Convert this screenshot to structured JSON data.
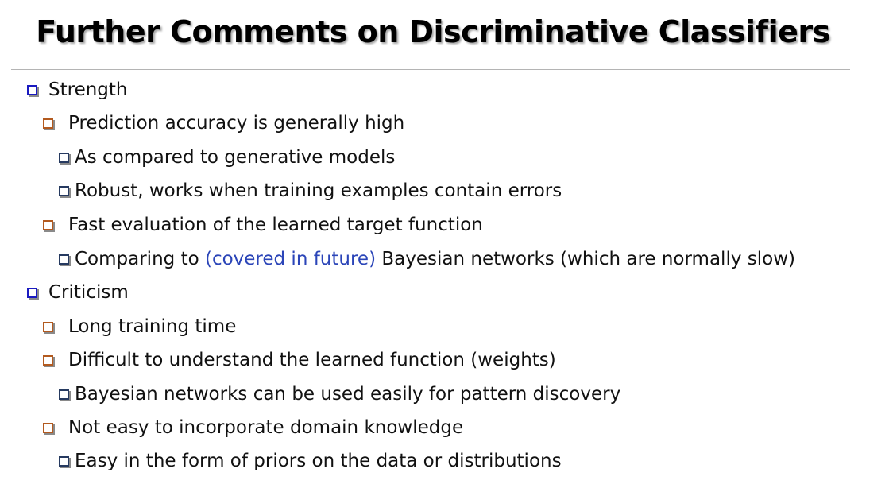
{
  "slide": {
    "title": "Further Comments on Discriminative Classifiers",
    "bullets": [
      {
        "level": 1,
        "text": "Strength"
      },
      {
        "level": 2,
        "text": "Prediction accuracy is generally high"
      },
      {
        "level": 3,
        "text": "As compared to generative models"
      },
      {
        "level": 3,
        "text": "Robust, works when training examples contain errors"
      },
      {
        "level": 2,
        "text": "Fast evaluation of the learned target function"
      },
      {
        "level": 3,
        "text_before": "Comparing to ",
        "text_highlight": "(covered in future)",
        "text_after": " Bayesian networks (which are normally slow)"
      },
      {
        "level": 1,
        "text": "Criticism"
      },
      {
        "level": 2,
        "text": "Long training time"
      },
      {
        "level": 2,
        "text": "Difficult to understand the learned function (weights)"
      },
      {
        "level": 3,
        "text": "Bayesian networks can be used easily for pattern discovery"
      },
      {
        "level": 2,
        "text": "Not easy to incorporate domain knowledge"
      },
      {
        "level": 3,
        "text": "Easy in the form of priors on the data or distributions"
      }
    ]
  },
  "colors": {
    "level1_bullet": "#1a1ac0",
    "level2_bullet": "#b35a1f",
    "level3_bullet": "#263a60",
    "highlight_text": "#2b45b8"
  },
  "icons": {
    "level1": "hollow-square-bullet-icon",
    "level2": "hollow-square-bullet-icon",
    "level3": "hollow-square-bullet-icon"
  }
}
